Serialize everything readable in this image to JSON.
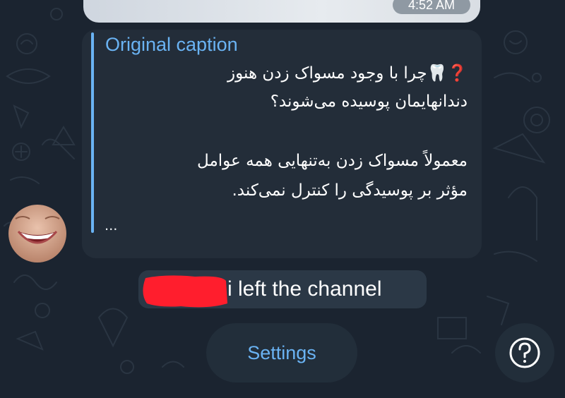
{
  "message": {
    "time": "4:52 AM",
    "quote_title": "Original caption",
    "caption_lines": [
      "❓🦷چرا با وجود مسواک زدن هنوز",
      "دندانهایمان پوسیده می‌شوند؟",
      "معمولاً مسواک زدن به‌تنهایی همه عوامل",
      "مؤثر بر پوسیدگی را کنترل نمی‌کند."
    ],
    "ellipsis": "..."
  },
  "service": {
    "text": "i left the channel"
  },
  "bottom_bar": {
    "settings_label": "Settings",
    "help_icon": "question-mark-circle"
  },
  "colors": {
    "background": "#1b2430",
    "bubble": "#232d39",
    "accent": "#6ab3f3",
    "redaction": "#ff1e2d"
  }
}
